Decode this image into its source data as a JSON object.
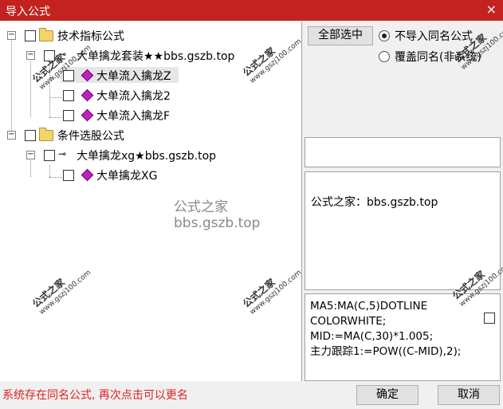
{
  "window": {
    "title": "导入公式",
    "close_glyph": "×"
  },
  "tree": {
    "group1": {
      "label": "技术指标公式",
      "suite_label": "大单擒龙套装★★bbs.gszb.top",
      "items": [
        "大单流入擒龙Z",
        "大单流入擒龙2",
        "大单流入擒龙F"
      ]
    },
    "group2": {
      "label": "条件选股公式",
      "suite_label": "大单擒龙xg★bbs.gszb.top",
      "items": [
        "大单擒龙XG"
      ]
    }
  },
  "options": {
    "select_all_label": "全部选中",
    "radio_skip_label": "不导入同名公式",
    "radio_overwrite_label": "覆盖同名(非系统)"
  },
  "description": "公式之家：bbs.gszb.top",
  "code_lines": [
    "MA5:MA(C,5)DOTLINE",
    "COLORWHITE;",
    "MID:=MA(C,30)*1.005;",
    "主力跟踪1:=POW((C-MID),2);"
  ],
  "status_text": "系统存在同名公式, 再次点击可以更名",
  "buttons": {
    "ok": "确定",
    "cancel": "取消"
  },
  "watermark": {
    "site": "公式之家 bbs.gszb.top",
    "stamp_cn": "公式之家",
    "stamp_url": "www.gszj100.com"
  },
  "colors": {
    "titlebar": "#c3231f",
    "status": "#e02020"
  }
}
